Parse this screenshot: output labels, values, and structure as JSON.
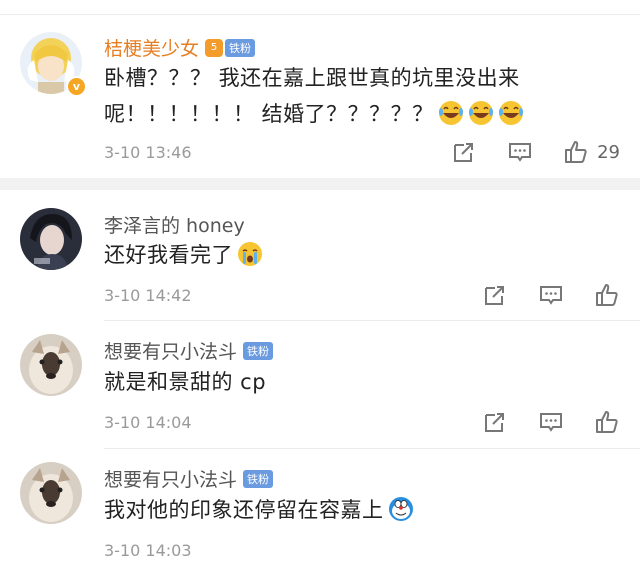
{
  "comments": [
    {
      "username": "桔梗美少女",
      "level_badge": "5",
      "fan_badge": "铁粉",
      "text_line1": "卧槽？？？ 我还在嘉上跟世真的坑里没出来",
      "text_line2": "呢！！！！！！ 结婚了？？？？？",
      "time": "3-10 13:46",
      "likes": "29"
    },
    {
      "username": "李泽言的 honey",
      "text": "还好我看完了",
      "time": "3-10 14:42"
    },
    {
      "username": "想要有只小法斗",
      "fan_badge": "铁粉",
      "text": "就是和景甜的 cp",
      "time": "3-10 14:04"
    },
    {
      "username": "想要有只小法斗",
      "fan_badge": "铁粉",
      "text": "我对他的印象还停留在容嘉上",
      "time": "3-10 14:03"
    }
  ],
  "colors": {
    "vip_name": "#e67e22",
    "fan_badge_bg": "#6a9ae0",
    "icon_gray": "#777777"
  },
  "icons": [
    "share-icon",
    "comment-icon",
    "like-icon",
    "laugh-cry-emoji",
    "crying-emoji",
    "doraemon-emoji"
  ]
}
